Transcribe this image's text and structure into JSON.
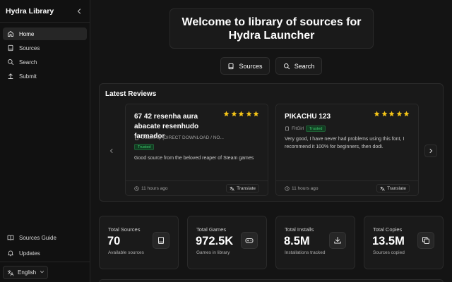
{
  "sidebar": {
    "title": "Hydra Library",
    "nav": [
      {
        "label": "Home",
        "icon": "home-icon",
        "active": true
      },
      {
        "label": "Sources",
        "icon": "book-icon"
      },
      {
        "label": "Search",
        "icon": "search-icon"
      },
      {
        "label": "Submit",
        "icon": "upload-icon"
      }
    ],
    "bottom_nav": [
      {
        "label": "Sources Guide",
        "icon": "book-open-icon"
      },
      {
        "label": "Updates",
        "icon": "bell-icon"
      }
    ],
    "language": "English"
  },
  "welcome": {
    "line1": "Welcome to library of sources for",
    "line2": "Hydra Launcher"
  },
  "actions": {
    "sources_label": "Sources",
    "search_label": "Search"
  },
  "reviews": {
    "title": "Latest Reviews",
    "items": [
      {
        "title": "67 42 resenha aura abacate resenhudo farmador",
        "rating": 5,
        "source": "SteamRip [DIRECT DOWNLOAD / NO...",
        "badge": "Trusted",
        "text": "Good source from the beloved reaper of Steam games",
        "time": "11 hours ago",
        "translate": "Translate"
      },
      {
        "title": "PIKACHU 123",
        "rating": 5,
        "source": "FitGirl",
        "badge": "Trusted",
        "text": "Very good, I have never had problems using this font, I recommend it 100% for beginners, then dodi.",
        "time": "11 hours ago",
        "translate": "Translate"
      }
    ]
  },
  "stats": [
    {
      "label": "Total Sources",
      "value": "70",
      "sub": "Available sources",
      "icon": "book-icon"
    },
    {
      "label": "Total Games",
      "value": "972.5K",
      "sub": "Games in library",
      "icon": "gamepad-icon"
    },
    {
      "label": "Total Installs",
      "value": "8.5M",
      "sub": "Installations tracked",
      "icon": "download-icon"
    },
    {
      "label": "Total Copies",
      "value": "13.5M",
      "sub": "Sources copied",
      "icon": "copy-icon"
    }
  ],
  "colors": {
    "background": "#141414",
    "panel": "#1a1a1a",
    "star": "#f5c518",
    "trusted": "#3ecf6e"
  }
}
